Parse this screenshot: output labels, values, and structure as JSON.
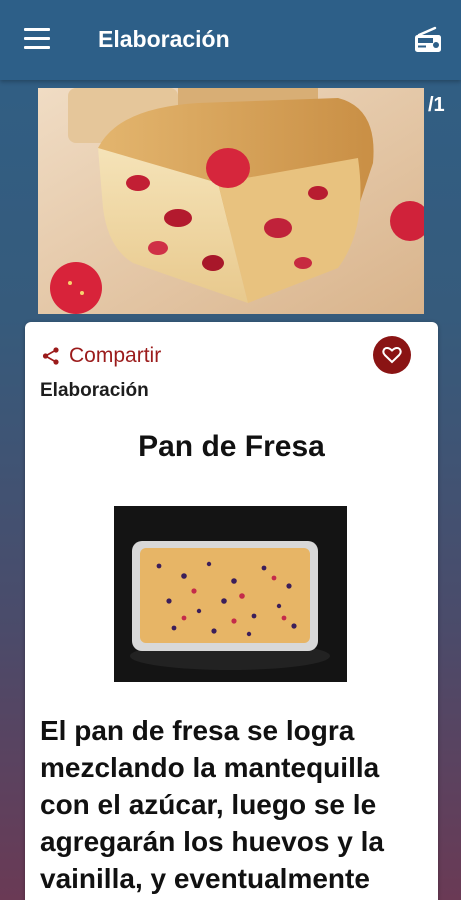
{
  "appbar": {
    "title": "Elaboración",
    "menu_icon": "menu-icon",
    "radio_icon": "radio-icon"
  },
  "hero": {
    "pager": "/1"
  },
  "card": {
    "share_label": "Compartir",
    "section_label": "Elaboración",
    "recipe_title": "Pan de Fresa",
    "body_text": "El pan de fresa se logra mezclando la mantequilla con el azúcar, luego se le agregarán los huevos y la vainilla, y eventualmente"
  },
  "colors": {
    "appbar": "#2d5f88",
    "accent": "#8a1414",
    "share_text": "#9b1b1b"
  }
}
